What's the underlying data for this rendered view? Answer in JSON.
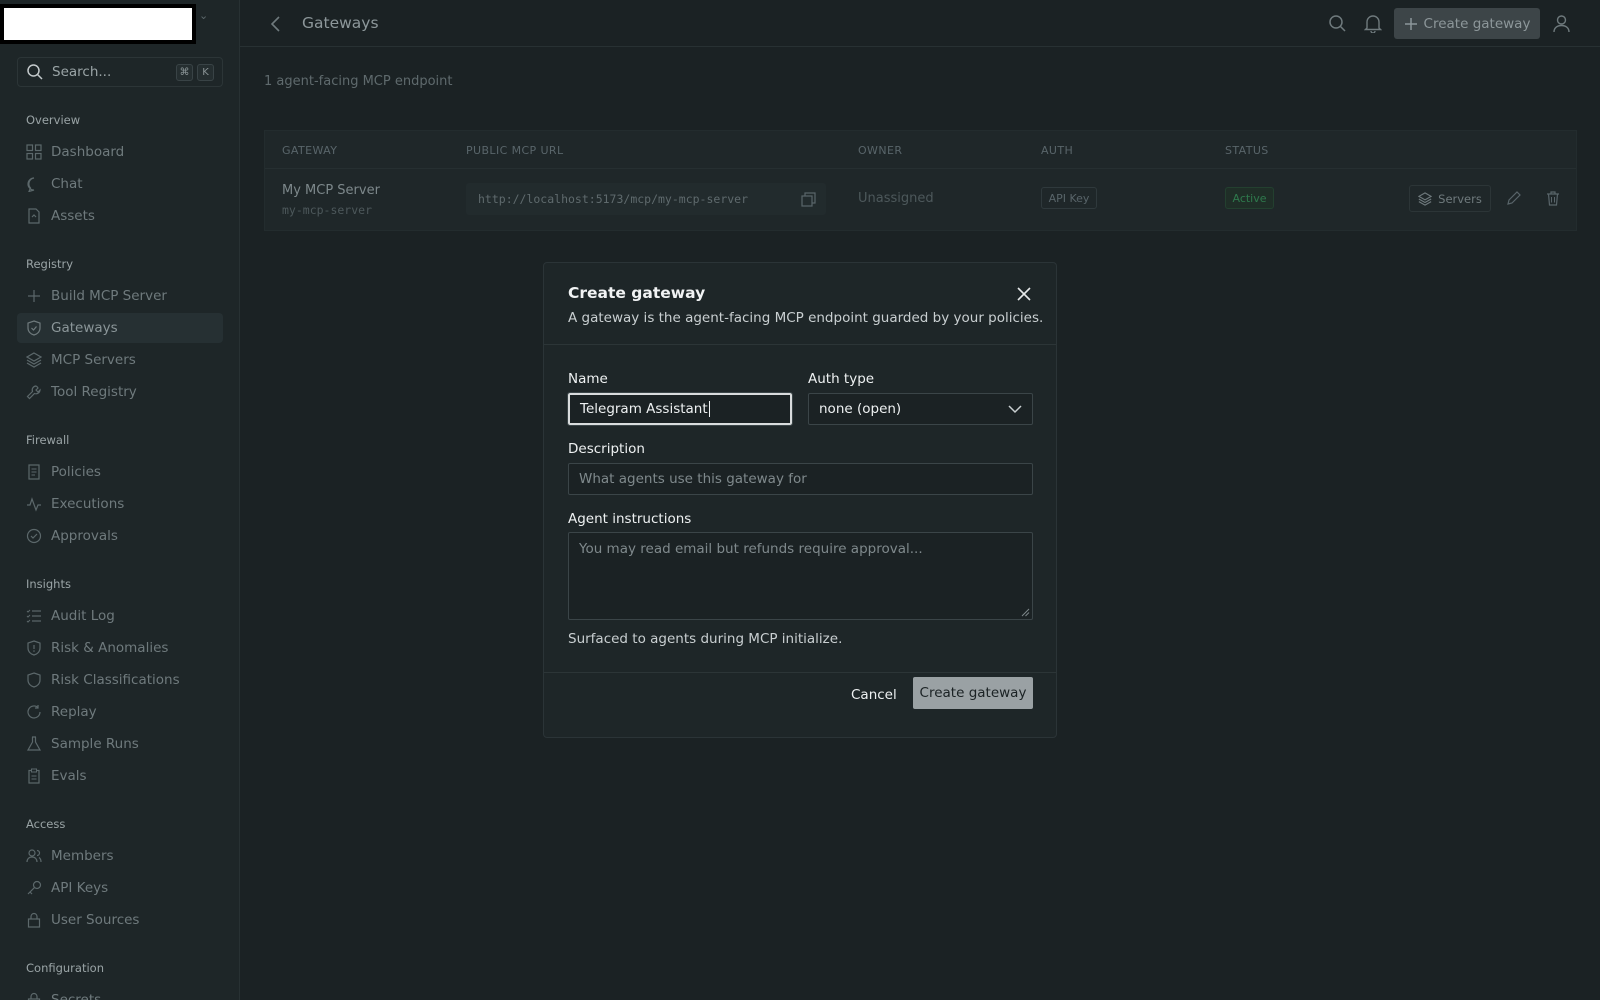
{
  "app": {
    "page_title": "Gateways",
    "top_create_label": "Create gateway"
  },
  "sidebar": {
    "search_placeholder": "Search...",
    "search_kbd": [
      "⌘",
      "K"
    ],
    "sections": [
      {
        "title": "Overview",
        "items": [
          {
            "label": "Dashboard",
            "icon": "grid-icon"
          },
          {
            "label": "Chat",
            "icon": "chat-icon"
          },
          {
            "label": "Assets",
            "icon": "asset-icon"
          }
        ]
      },
      {
        "title": "Registry",
        "items": [
          {
            "label": "Build MCP Server",
            "icon": "plus-icon"
          },
          {
            "label": "Gateways",
            "icon": "shield-icon",
            "active": true
          },
          {
            "label": "MCP Servers",
            "icon": "layers-icon"
          },
          {
            "label": "Tool Registry",
            "icon": "wrench-icon"
          }
        ]
      },
      {
        "title": "Firewall",
        "items": [
          {
            "label": "Policies",
            "icon": "document-icon"
          },
          {
            "label": "Executions",
            "icon": "activity-icon"
          },
          {
            "label": "Approvals",
            "icon": "check-circle-icon"
          }
        ]
      },
      {
        "title": "Insights",
        "items": [
          {
            "label": "Audit Log",
            "icon": "list-icon"
          },
          {
            "label": "Risk & Anomalies",
            "icon": "shield-alert-icon"
          },
          {
            "label": "Risk Classifications",
            "icon": "shield-icon"
          },
          {
            "label": "Replay",
            "icon": "replay-icon"
          },
          {
            "label": "Sample Runs",
            "icon": "flask-icon"
          },
          {
            "label": "Evals",
            "icon": "clipboard-icon"
          }
        ]
      },
      {
        "title": "Access",
        "items": [
          {
            "label": "Members",
            "icon": "users-icon"
          },
          {
            "label": "API Keys",
            "icon": "key-icon"
          },
          {
            "label": "User Sources",
            "icon": "lock-icon"
          }
        ]
      },
      {
        "title": "Configuration",
        "items": [
          {
            "label": "Secrets",
            "icon": "secret-icon"
          }
        ]
      }
    ]
  },
  "main": {
    "subtitle": "1 agent-facing MCP endpoint",
    "table": {
      "headers": [
        "GATEWAY",
        "PUBLIC MCP URL",
        "OWNER",
        "AUTH",
        "STATUS"
      ],
      "rows": [
        {
          "name": "My MCP Server",
          "slug": "my-mcp-server",
          "url": "http://localhost:5173/mcp/my-mcp-server",
          "owner": "Unassigned",
          "auth": "API Key",
          "status": "Active",
          "servers_label": "Servers"
        }
      ]
    }
  },
  "modal": {
    "title": "Create gateway",
    "description": "A gateway is the agent-facing MCP endpoint guarded by your policies.",
    "name_label": "Name",
    "name_value": "Telegram Assistant",
    "auth_label": "Auth type",
    "auth_value": "none (open)",
    "description_label": "Description",
    "description_placeholder": "What agents use this gateway for",
    "instructions_label": "Agent instructions",
    "instructions_placeholder": "You may read email but refunds require approval...",
    "instructions_hint": "Surfaced to agents during MCP initialize.",
    "cancel_label": "Cancel",
    "create_label": "Create gateway"
  }
}
